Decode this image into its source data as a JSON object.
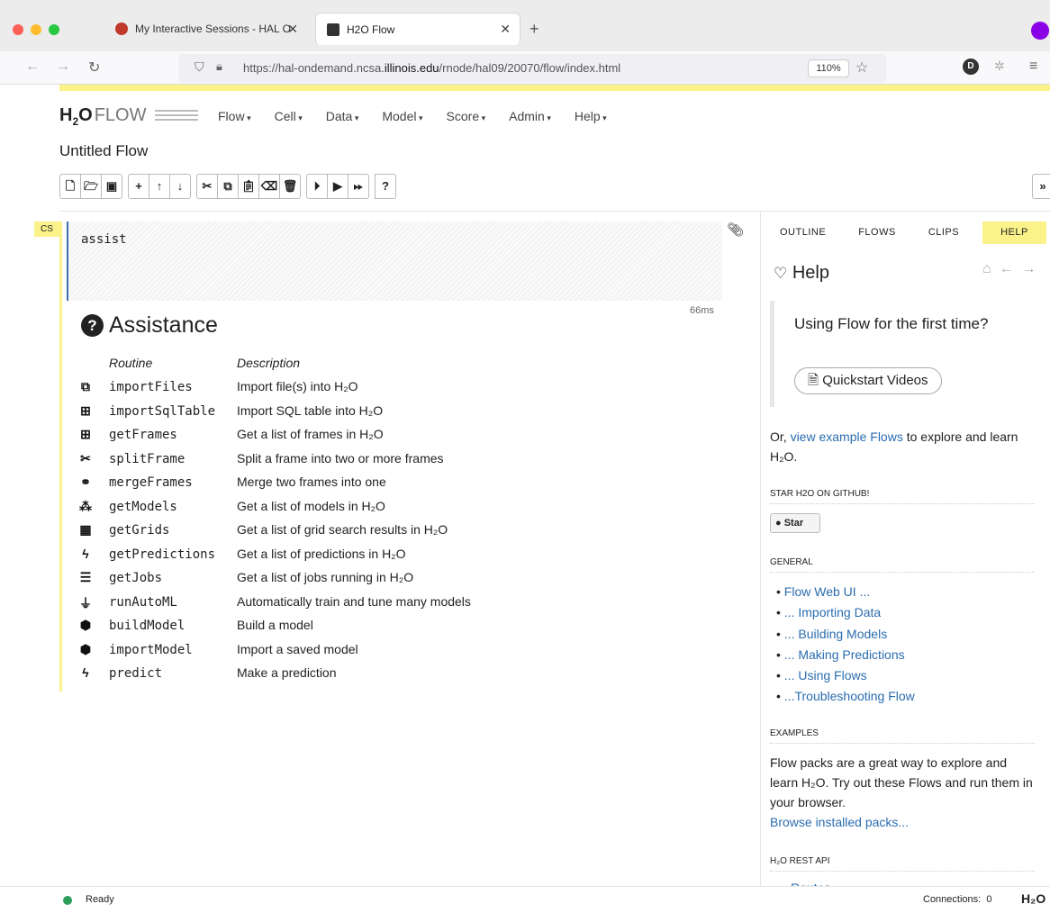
{
  "browser": {
    "tabs": [
      {
        "label": "My Interactive Sessions - HAL O"
      },
      {
        "label": "H2O Flow"
      }
    ],
    "url_prefix": "https://hal-ondemand.ncsa.",
    "url_domain": "illinois.edu",
    "url_suffix": "/rnode/hal09/20070/flow/index.html",
    "zoom": "110%",
    "avatar_letter": "D"
  },
  "app": {
    "logo_h": "H",
    "logo_sub": "2",
    "logo_o": "O",
    "logo_flow": "FLOW",
    "menu": [
      "Flow",
      "Cell",
      "Data",
      "Model",
      "Score",
      "Admin",
      "Help"
    ],
    "flow_title": "Untitled Flow"
  },
  "cell": {
    "type_badge": "CS",
    "code": "assist",
    "elapsed": "66ms"
  },
  "assistance": {
    "title": "Assistance",
    "col_routine": "Routine",
    "col_description": "Description",
    "routines": [
      {
        "icon": "copy-icon",
        "glyph": "⧉",
        "name": "importFiles",
        "description": "Import file(s) into H₂O"
      },
      {
        "icon": "table-icon",
        "glyph": "⊞",
        "name": "importSqlTable",
        "description": "Import SQL table into H₂O"
      },
      {
        "icon": "table-icon",
        "glyph": "⊞",
        "name": "getFrames",
        "description": "Get a list of frames in H₂O"
      },
      {
        "icon": "scissors-icon",
        "glyph": "✂",
        "name": "splitFrame",
        "description": "Split a frame into two or more frames"
      },
      {
        "icon": "link-icon",
        "glyph": "⚭",
        "name": "mergeFrames",
        "description": "Merge two frames into one"
      },
      {
        "icon": "cubes-icon",
        "glyph": "⁂",
        "name": "getModels",
        "description": "Get a list of models in H₂O"
      },
      {
        "icon": "grid-icon",
        "glyph": "▦",
        "name": "getGrids",
        "description": "Get a list of grid search results in H₂O"
      },
      {
        "icon": "bolt-icon",
        "glyph": "ϟ",
        "name": "getPredictions",
        "description": "Get a list of predictions in H₂O"
      },
      {
        "icon": "tasks-icon",
        "glyph": "☰",
        "name": "getJobs",
        "description": "Get a list of jobs running in H₂O"
      },
      {
        "icon": "sitemap-icon",
        "glyph": "⏚",
        "name": "runAutoML",
        "description": "Automatically train and tune many models"
      },
      {
        "icon": "cube-icon",
        "glyph": "⬢",
        "name": "buildModel",
        "description": "Build a model"
      },
      {
        "icon": "cube-icon",
        "glyph": "⬢",
        "name": "importModel",
        "description": "Import a saved model"
      },
      {
        "icon": "bolt-icon",
        "glyph": "ϟ",
        "name": "predict",
        "description": "Make a prediction"
      }
    ]
  },
  "right_panel": {
    "tabs": [
      "OUTLINE",
      "FLOWS",
      "CLIPS",
      "HELP"
    ],
    "active_tab": "HELP",
    "help_title": "Help",
    "callout_text": "Using Flow for the first time?",
    "quickstart_label": "Quickstart Videos",
    "examples_pre": "Or, ",
    "examples_link": "view example Flows",
    "examples_post": " to explore and learn H₂O.",
    "github_heading": "STAR H2O ON GITHUB!",
    "star_label": "Star",
    "general_heading": "GENERAL",
    "general_links": [
      "Flow Web UI ...",
      "... Importing Data",
      "... Building Models",
      "... Making Predictions",
      "... Using Flows",
      "...Troubleshooting Flow"
    ],
    "examples_heading": "EXAMPLES",
    "examples_text": "Flow packs are a great way to explore and learn H₂O. Try out these Flows and run them in your browser.",
    "browse_packs": "Browse installed packs...",
    "rest_api_heading": "H₂O REST API",
    "rest_partial": "Routes"
  },
  "status": {
    "state": "Ready",
    "connections_label": "Connections:",
    "connections": "0",
    "logo": "H₂O"
  }
}
